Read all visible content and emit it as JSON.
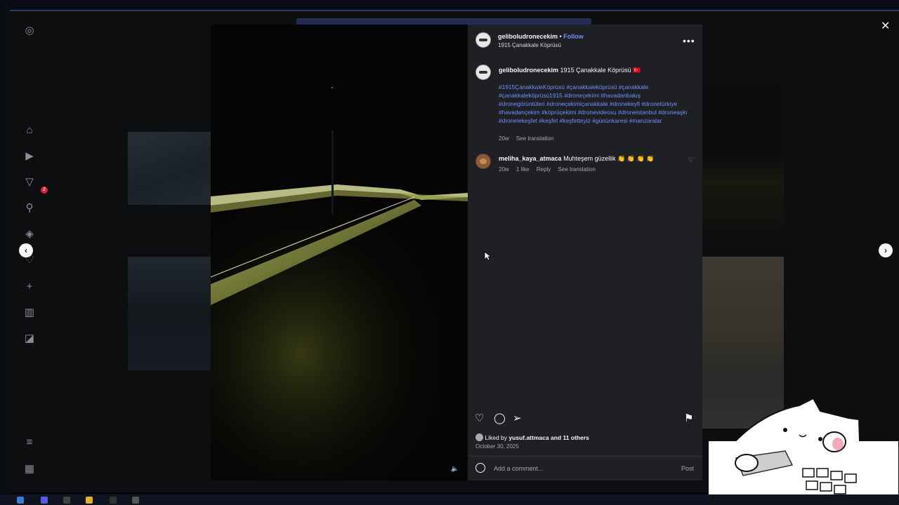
{
  "post": {
    "username": "geliboludronecekim",
    "follow_label": "Follow",
    "location": "1915 Çanakkale Köprüsü",
    "more_label": "•••",
    "caption_user": "geliboludronecekim",
    "caption_text": "1915 Çanakkale Köprüsü 🇹🇷",
    "hashtags": "#1915ÇanakkaleKöprüsü #çanakkaleköprüsü #çanakkale #çanakkaleköprüsü1915 #droneçekimi #havadanbakış #dronegörüntüleri #droneçekimiçanakkale #dronekeyfi #dronetürkiye #havadançekim #köprüçekimi #dronevideosu #droneistanbul #droneaşkı #dronelekeşfet #keşfet #keşfetteyiz #gününkaresi #manzaralar",
    "caption_age": "20w",
    "caption_translate": "See translation"
  },
  "comment": {
    "user": "meliha_kaya_atmaca",
    "text": "Muhteşem güzellik 👏 👏 👏 👏",
    "age": "20w",
    "likes": "1 like",
    "reply": "Reply",
    "translate": "See translation"
  },
  "likes": {
    "prefix": "Liked by",
    "user": "yusuf.attmaca",
    "suffix": "and 11 others",
    "date": "October 30, 2025"
  },
  "composer": {
    "placeholder": "Add a comment...",
    "post_label": "Post"
  },
  "icons": {
    "close": "✕",
    "prev": "‹",
    "next": "›",
    "mute": "🔈"
  },
  "colors": {
    "link": "#6e8fff",
    "panel": "#1f2024",
    "bridge_light": "#c8cf7a"
  }
}
